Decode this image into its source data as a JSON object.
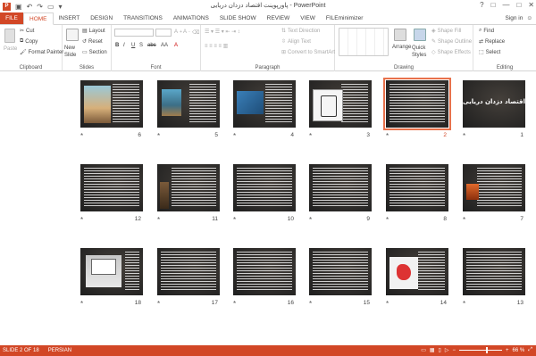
{
  "window": {
    "title": "پاورپوینت اقتصاد دزدان دریایی - PowerPoint",
    "controls": [
      "?",
      "□",
      "—",
      "□",
      "✕"
    ]
  },
  "qat_icons": [
    "save-icon",
    "undo-icon",
    "redo-icon",
    "start-from-beginning-icon"
  ],
  "tabs": [
    "FILE",
    "HOME",
    "INSERT",
    "DESIGN",
    "TRANSITIONS",
    "ANIMATIONS",
    "SLIDE SHOW",
    "REVIEW",
    "VIEW",
    "FILEminimizer"
  ],
  "active_tab": "HOME",
  "signin": "Sign in",
  "ribbon": {
    "clipboard": {
      "label": "Clipboard",
      "paste": "Paste",
      "cut": "Cut",
      "copy": "Copy",
      "format_painter": "Format Painter"
    },
    "slides": {
      "label": "Slides",
      "new_slide": "New Slide",
      "layout": "Layout",
      "reset": "Reset",
      "section": "Section"
    },
    "font": {
      "label": "Font",
      "bold": "B",
      "italic": "I",
      "underline": "U",
      "shadow": "S",
      "strike": "abc",
      "aa": "AA",
      "fontcolor": "A"
    },
    "paragraph": {
      "label": "Paragraph",
      "text_direction": "Text Direction",
      "align_text": "Align Text",
      "convert_smartart": "Convert to SmartArt"
    },
    "drawing": {
      "label": "Drawing",
      "arrange": "Arrange",
      "quick_styles": "Quick Styles",
      "shape_fill": "Shape Fill",
      "shape_outline": "Shape Outline",
      "shape_effects": "Shape Effects"
    },
    "editing": {
      "label": "Editing",
      "find": "Find",
      "replace": "Replace",
      "select": "Select"
    }
  },
  "slides": [
    {
      "number": "1",
      "kind": "cover",
      "title": "اقتصاد دزدان دریایی"
    },
    {
      "number": "2",
      "kind": "text",
      "selected": true
    },
    {
      "number": "3",
      "kind": "ship"
    },
    {
      "number": "4",
      "kind": "blue"
    },
    {
      "number": "5",
      "kind": "chest"
    },
    {
      "number": "6",
      "kind": "pirate"
    },
    {
      "number": "7",
      "kind": "orange"
    },
    {
      "number": "8",
      "kind": "text"
    },
    {
      "number": "9",
      "kind": "text"
    },
    {
      "number": "10",
      "kind": "text"
    },
    {
      "number": "11",
      "kind": "pirate2"
    },
    {
      "number": "12",
      "kind": "text"
    },
    {
      "number": "13",
      "kind": "text"
    },
    {
      "number": "14",
      "kind": "map"
    },
    {
      "number": "15",
      "kind": "text"
    },
    {
      "number": "16",
      "kind": "text"
    },
    {
      "number": "17",
      "kind": "text"
    },
    {
      "number": "18",
      "kind": "laptop"
    }
  ],
  "statusbar": {
    "slide_info": "SLIDE 2 OF 18",
    "language": "PERSIAN",
    "zoom": "66 %",
    "zoom_level": 0.66
  }
}
